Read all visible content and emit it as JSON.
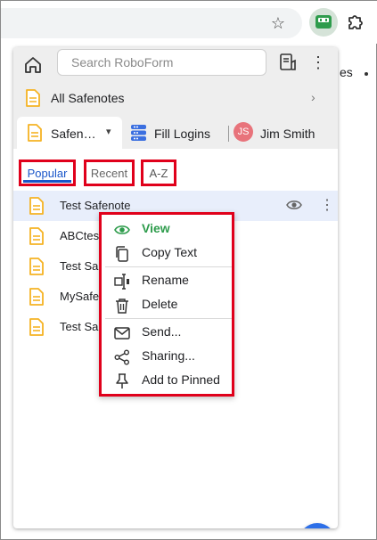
{
  "browser": {
    "star_icon": "star-icon",
    "extension_icon": "roboform-icon",
    "puzzle_icon": "puzzle-icon",
    "background_text": "es"
  },
  "popup": {
    "search_placeholder": "Search RoboForm",
    "folder_label": "All Safenotes",
    "tabs": {
      "active_label": "Safen…",
      "fill_logins_label": "Fill Logins",
      "user_initials": "JS",
      "user_name": "Jim Smith"
    },
    "subtabs": {
      "popular": "Popular",
      "recent": "Recent",
      "az": "A-Z"
    },
    "items": [
      {
        "label": "Test Safenote"
      },
      {
        "label": "ABCtes"
      },
      {
        "label": "Test Sa"
      },
      {
        "label": "MySafe"
      },
      {
        "label": "Test Sa"
      }
    ],
    "context_menu": [
      {
        "label": "View",
        "icon": "eye-icon"
      },
      {
        "label": "Copy Text",
        "icon": "copy-icon"
      },
      {
        "label": "Rename",
        "icon": "rename-icon"
      },
      {
        "label": "Delete",
        "icon": "trash-icon"
      },
      {
        "label": "Send...",
        "icon": "envelope-icon"
      },
      {
        "label": "Sharing...",
        "icon": "share-icon"
      },
      {
        "label": "Add to Pinned",
        "icon": "pin-icon"
      }
    ],
    "fab_label": "+"
  },
  "colors": {
    "accent_blue": "#2d6fe8",
    "roboform_green": "#2e9c4c",
    "highlight_red": "#e0001b",
    "note_yellow": "#f5b323"
  }
}
